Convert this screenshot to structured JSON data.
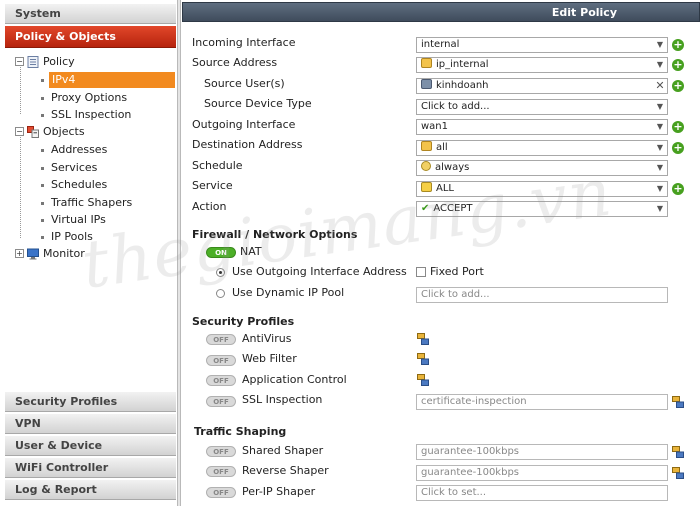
{
  "sidebar": {
    "top_sections": [
      {
        "label": "System"
      },
      {
        "label": "Policy & Objects",
        "active": true
      }
    ],
    "tree": {
      "policy": {
        "label": "Policy",
        "children": [
          "IPv4",
          "Proxy Options",
          "SSL Inspection"
        ],
        "selected": "IPv4"
      },
      "objects": {
        "label": "Objects",
        "children": [
          "Addresses",
          "Services",
          "Schedules",
          "Traffic Shapers",
          "Virtual IPs",
          "IP Pools"
        ]
      },
      "monitor": {
        "label": "Monitor"
      }
    },
    "bottom_sections": [
      {
        "label": "Security Profiles"
      },
      {
        "label": "VPN"
      },
      {
        "label": "User & Device"
      },
      {
        "label": "WiFi Controller"
      },
      {
        "label": "Log & Report"
      }
    ]
  },
  "header": {
    "title": "Edit Policy"
  },
  "form": {
    "incoming_interface": {
      "label": "Incoming Interface",
      "value": "internal"
    },
    "source_address": {
      "label": "Source Address",
      "value": "ip_internal"
    },
    "source_users": {
      "label": "Source User(s)",
      "value": "kinhdoanh"
    },
    "source_device_type": {
      "label": "Source Device Type",
      "value": "Click to add..."
    },
    "outgoing_interface": {
      "label": "Outgoing Interface",
      "value": "wan1"
    },
    "destination_address": {
      "label": "Destination Address",
      "value": "all"
    },
    "schedule": {
      "label": "Schedule",
      "value": "always"
    },
    "service": {
      "label": "Service",
      "value": "ALL"
    },
    "action": {
      "label": "Action",
      "value": "ACCEPT"
    }
  },
  "firewall": {
    "heading": "Firewall / Network Options",
    "nat": {
      "label": "NAT",
      "state": "ON"
    },
    "use_outgoing": {
      "label": "Use Outgoing Interface Address",
      "selected": true
    },
    "fixed_port": {
      "label": "Fixed Port",
      "checked": false
    },
    "use_dynamic": {
      "label": "Use Dynamic IP Pool",
      "selected": false
    },
    "dynamic_placeholder": "Click to add..."
  },
  "security_profiles": {
    "heading": "Security Profiles",
    "items": [
      {
        "label": "AntiVirus",
        "state": "OFF"
      },
      {
        "label": "Web Filter",
        "state": "OFF"
      },
      {
        "label": "Application Control",
        "state": "OFF"
      },
      {
        "label": "SSL Inspection",
        "state": "OFF",
        "value": "certificate-inspection"
      }
    ]
  },
  "traffic_shaping": {
    "heading": "Traffic Shaping",
    "items": [
      {
        "label": "Shared Shaper",
        "state": "OFF",
        "value": "guarantee-100kbps"
      },
      {
        "label": "Reverse Shaper",
        "state": "OFF",
        "value": "guarantee-100kbps"
      },
      {
        "label": "Per-IP Shaper",
        "state": "OFF",
        "value": "Click to set..."
      }
    ]
  },
  "watermark": "thegioimang.vn",
  "colors": {
    "active_section": "#c8321a",
    "selected_leaf": "#f28a1f",
    "header": "#4a5767",
    "plus": "#47a01f",
    "toggle_on": "#4caf27"
  },
  "icons": {
    "dropdown": "chevron-down-icon",
    "add": "plus-circle-icon",
    "profile": "profile-config-icon",
    "clear": "close-icon"
  }
}
